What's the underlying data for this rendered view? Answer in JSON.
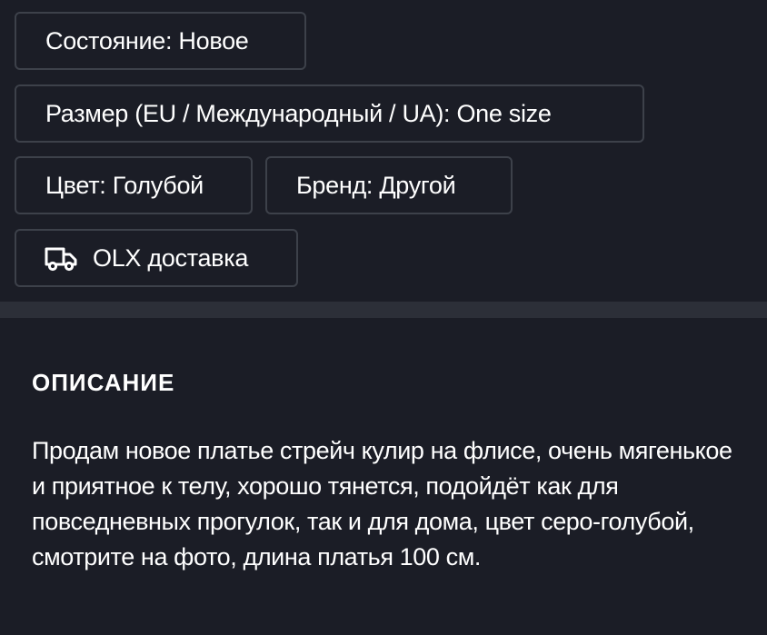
{
  "params": {
    "condition": "Состояние: Новое",
    "size": "Размер (EU / Международный / UA): One size",
    "color": "Цвет: Голубой",
    "brand": "Бренд: Другой"
  },
  "delivery": {
    "icon": "delivery-truck-icon",
    "label": "OLX доставка"
  },
  "description": {
    "title": "ОПИСАНИЕ",
    "text": "Продам новое платье стрейч кулир на флисе, очень мягенькое и приятное к телу, хорошо тянется, подойдёт как для повседневных прогулок, так и для дома, цвет серо-голубой, смотрите на фото, длина платья 100 см."
  },
  "colors": {
    "background": "#1b1d26",
    "tag_border": "#3d414a",
    "divider": "#2c2f38",
    "text": "#ffffff"
  }
}
